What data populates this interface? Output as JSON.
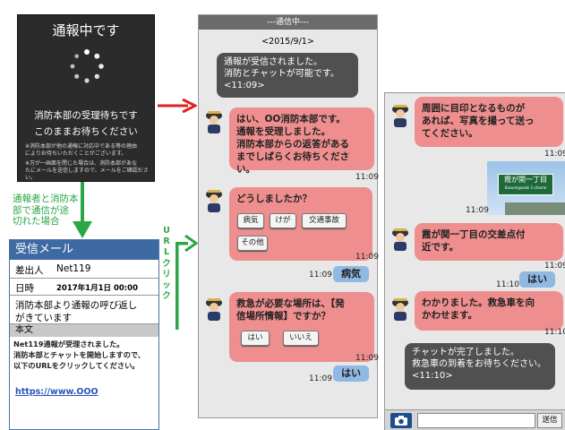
{
  "panel_calling": {
    "title": "通報中です",
    "status_line1": "消防本部の受理待ちです",
    "status_line2": "このままお待ちください",
    "note1_line1": "※消防本部が他の通報に対応中である等の理由",
    "note1_line2": "によりお待ちいただくことがございます。",
    "note2_line1": "※万が一画面を閉じた場合は、消防本部があな",
    "note2_line2": "たにメールを送信しますので、メールをご確認ださ",
    "note2_line3": "い。"
  },
  "annotations": {
    "disconnect_line1": "通報者と消防本",
    "disconnect_line2": "部で通信が途",
    "disconnect_line3": "切れた場合",
    "url_click_chars": [
      "U",
      "R",
      "L",
      "ク",
      "リ",
      "ッ",
      "ク"
    ]
  },
  "email": {
    "header": "受信メール",
    "from_label": "差出人",
    "from_value": "Net119",
    "date_label": "日時",
    "date_value": "2017年1月1日 00:00",
    "subject_line1": "消防本部より通報の呼び返し",
    "subject_line2": "がきています",
    "body_label": "本文",
    "body_line1": "Net119通報が受理されました。",
    "body_line2": "消防本部とチャットを開始しますので、",
    "body_line3": "以下のURLをクリックしてください。",
    "link": "https://www.OOO"
  },
  "chat1": {
    "header": "---通信中---",
    "date": "<2015/9/1>",
    "sys_line1": "通報が受信されました。",
    "sys_line2": "消防とチャットが可能です。",
    "sys_line3": "<11:09>",
    "msg1_line1": "はい、OO消防本部です。",
    "msg1_line2": "通報を受理しました。",
    "msg1_line3": "消防本部からの返答がある",
    "msg1_line4": "までしばらくお待ちください。",
    "msg1_time": "11:09",
    "msg2_text": "どうしましたか？",
    "msg2_options": [
      "病気",
      "けが",
      "交通事故",
      "その他"
    ],
    "msg2_time": "11:09",
    "reply1_time": "11:09",
    "reply1_text": "病気",
    "msg3_line1": "救急が必要な場所は、【発",
    "msg3_line2": "信場所情報】ですか？",
    "msg3_options": [
      "はい",
      "いいえ"
    ],
    "msg3_time": "11:09",
    "reply2_time": "11:09",
    "reply2_text": "はい"
  },
  "chat2": {
    "msg1_line1": "周囲に目印となるものが",
    "msg1_line2": "あれば、写真を撮って送っ",
    "msg1_line3": "てください。",
    "msg1_time": "11:09",
    "photo_sign": "霞が関一丁目",
    "photo_sign_sub": "Kasumigaseki 1-chome",
    "photo_time": "11:09",
    "msg2_line1": "霞が関一丁目の交差点付",
    "msg2_line2": "近です。",
    "msg2_time": "11:09",
    "reply_time": "11:10",
    "reply_text": "はい",
    "msg3_line1": "わかりました。救急車を向",
    "msg3_line2": "かわせます。",
    "msg3_time": "11:10",
    "sys_line1": "チャットが完了しました。",
    "sys_line2": "救急車の到着をお待ちください。",
    "sys_line3": "<11:10>",
    "send_label": "送信",
    "camera_icon": "camera-icon"
  },
  "colors": {
    "red_arrow": "#e02020",
    "green_arrow": "#2aa744",
    "pink_bubble": "#ee8e8e",
    "blue_bubble": "#8fb8e2",
    "dark_bubble": "#505050"
  }
}
